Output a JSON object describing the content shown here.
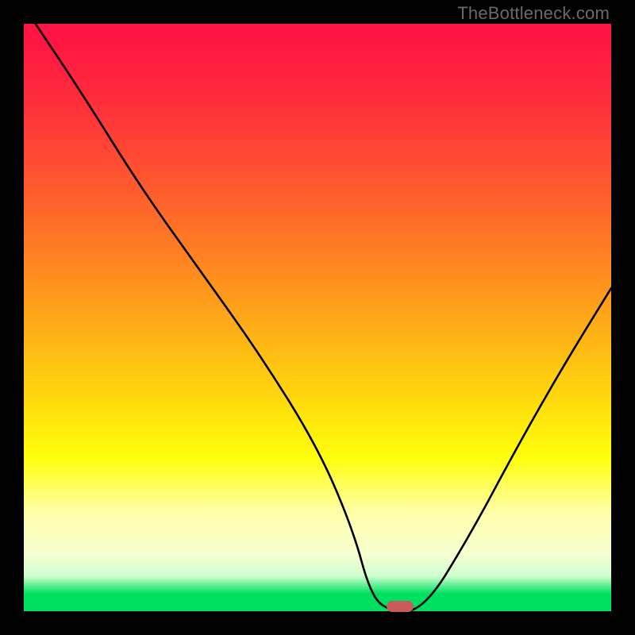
{
  "watermark": "TheBottleneck.com",
  "chart_data": {
    "type": "line",
    "title": "",
    "xlabel": "",
    "ylabel": "",
    "xlim": [
      0,
      100
    ],
    "ylim": [
      0,
      100
    ],
    "grid": false,
    "legend": false,
    "series": [
      {
        "name": "bottleneck-curve",
        "x": [
          2,
          10,
          20,
          30,
          40,
          50,
          56,
          59,
          62,
          68,
          76,
          84,
          92,
          100
        ],
        "y": [
          100,
          88,
          72,
          58,
          44,
          28,
          14,
          3,
          0,
          0,
          13,
          28,
          42,
          55
        ]
      }
    ],
    "marker": {
      "x": 64,
      "y": 0,
      "color": "#c85a5a"
    },
    "gradient_stops": [
      {
        "pct": 0,
        "color": "#ff1444"
      },
      {
        "pct": 28,
        "color": "#ff5a2e"
      },
      {
        "pct": 55,
        "color": "#ffb914"
      },
      {
        "pct": 74,
        "color": "#ffff0c"
      },
      {
        "pct": 90,
        "color": "#f8ffd0"
      },
      {
        "pct": 100,
        "color": "#00e060"
      }
    ]
  }
}
